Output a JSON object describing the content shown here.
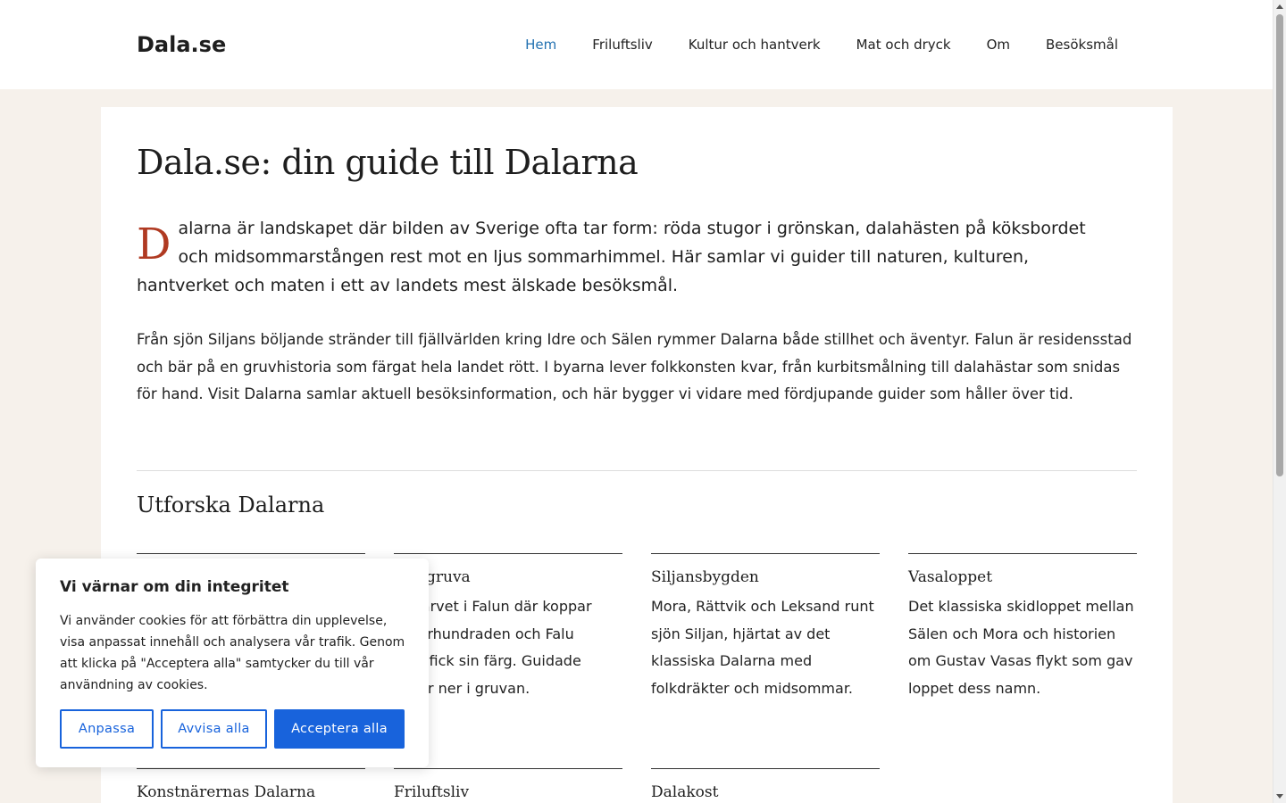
{
  "site": {
    "logo": "Dala.se"
  },
  "nav": {
    "items": [
      "Hem",
      "Friluftsliv",
      "Kultur och hantverk",
      "Mat och dryck",
      "Om",
      "Besöksmål"
    ],
    "active_color": "#2271b1"
  },
  "article": {
    "title": "Dala.se: din guide till Dalarna",
    "lead_dropcap": "D",
    "lead_rest": "alarna är landskapet där bilden av Sverige ofta tar form: röda stugor i grönskan, dalahästen på köksbordet och midsommarstången rest mot en ljus sommarhimmel. Här samlar vi guider till naturen, kulturen, hantverket och maten i ett av landets mest älskade besöksmål.",
    "body": "Från sjön Siljans böljande stränder till fjällvärlden kring Idre och Sälen rymmer Dalarna både stillhet och äventyr. Falun är residensstad och bär på en gruvhistoria som färgat hela landet rött. I byarna lever folkkonsten kvar, från kurbitsmålning till dalahästar som snidas för hand. Visit Dalarna samlar aktuell besöksinformation, och här bygger vi vidare med fördjupande guider som håller över tid."
  },
  "explore": {
    "title": "Utforska Dalarna",
    "cards": [
      {
        "title": "",
        "text": ""
      },
      {
        "title": "gruva",
        "text": "lsarvet i Falun där koppar\n i århundraden och Falu\nrg fick sin färg. Guidade\n går ner i gruvan."
      },
      {
        "title": "Siljansbygden",
        "text": "Mora, Rättvik och Leksand runt sjön Siljan, hjärtat av det klassiska Dalarna med folkdräkter och midsommar."
      },
      {
        "title": "Vasaloppet",
        "text": "Det klassiska skidloppet mellan Sälen och Mora och historien om Gustav Vasas flykt som gav loppet dess namn."
      },
      {
        "title": "Konstnärernas Dalarna",
        "text": ""
      },
      {
        "title": "Friluftsliv",
        "text": ""
      },
      {
        "title": "Dalakost",
        "text": ""
      }
    ]
  },
  "cookie": {
    "title": "Vi värnar om din integritet",
    "text": "Vi använder cookies för att förbättra din upplevelse, visa anpassat innehåll och analysera vår trafik. Genom att klicka på \"Acceptera alla\" samtycker du till vår användning av cookies.",
    "customize": "Anpassa",
    "reject": "Avvisa alla",
    "accept": "Acceptera alla",
    "button_color": "#1863dc"
  },
  "colors": {
    "background": "#f6f1eb",
    "dropcap": "#b03a22"
  }
}
